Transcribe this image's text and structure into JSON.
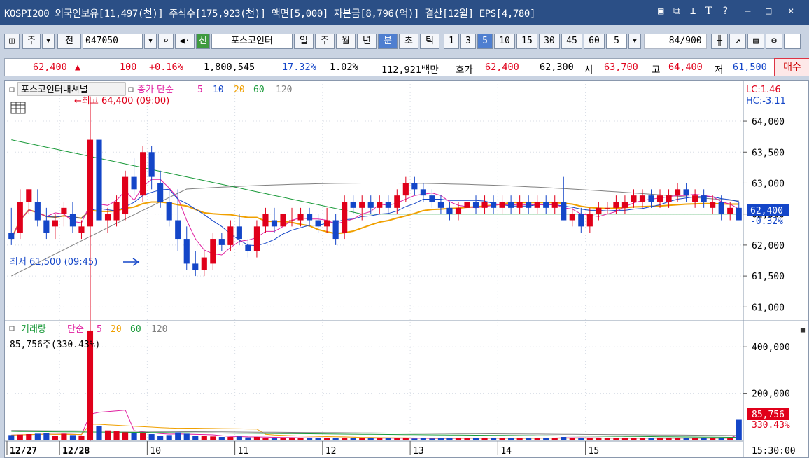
{
  "title_bar": {
    "text": "KOSPI200 외국인보유[11,497(천)] 주식수[175,923(천)] 액면[5,000] 자본금[8,796(억)] 결산[12월] EPS[4,780]",
    "icons": [
      "window-icon",
      "restore-icon",
      "pin-icon",
      "text-icon",
      "help-icon",
      "minimize-icon",
      "maximize-icon",
      "close-icon"
    ]
  },
  "toolbar": {
    "stock_type": "주",
    "prev": "전",
    "code": "047050",
    "market_badge": "신",
    "stock_name": "포스코인터",
    "periods": [
      "일",
      "주",
      "월",
      "년",
      "분",
      "초",
      "틱"
    ],
    "selected_period": "분",
    "intervals": [
      "1",
      "3",
      "5",
      "10",
      "15",
      "30",
      "45",
      "60"
    ],
    "selected_interval": "5",
    "interval_select": "5",
    "count": "84",
    "count_max": "/900"
  },
  "quote": {
    "price": "62,400",
    "arrow": "▲",
    "change": "100",
    "change_pct": "+0.16%",
    "volume": "1,800,545",
    "turnover": "17.32%",
    "ratio": "1.02%",
    "amount": "112,921백만",
    "ask_label": "호가",
    "ask": "62,400",
    "bid": "62,300",
    "open_label": "시",
    "open": "63,700",
    "high_label": "고",
    "high": "64,400",
    "low_label": "저",
    "low": "61,500",
    "buy_button": "매수"
  },
  "price_chart": {
    "name_tab": "포스코인터내셔널",
    "legend_prefix": "종가 단순",
    "ma_periods": [
      "5",
      "10",
      "20",
      "60",
      "120"
    ],
    "high_annotation": "←최고 64,400 (09:00)",
    "low_annotation": "최저 61,500 (09:45)",
    "lc": "LC:1.46",
    "hc": "HC:-3.11",
    "y_ticks": [
      "64,000",
      "63,500",
      "63,000",
      "62,500",
      "62,000",
      "61,500",
      "61,000"
    ],
    "current_price": "62,400",
    "current_pct": "-0.32%"
  },
  "volume_chart": {
    "legend_label": "거래량",
    "legend_prefix": "단순",
    "ma_periods": [
      "5",
      "20",
      "60",
      "120"
    ],
    "info": "85,756주(330.43%)",
    "y_ticks": [
      "400,000",
      "200,000"
    ],
    "current_value": "85,756",
    "current_pct": "330.43%"
  },
  "x_axis": {
    "labels": [
      "12/27",
      "12/28",
      "10",
      "11",
      "12",
      "13",
      "14",
      "15"
    ],
    "time": "15:30:00"
  },
  "colors": {
    "up": "#e0001a",
    "down": "#1446c8",
    "ma5": "#e020a0",
    "ma10": "#1446c8",
    "ma20": "#f0a000",
    "ma60": "#1a9a3a",
    "ma120": "#808080"
  },
  "chart_data": [
    {
      "type": "candlestick",
      "series": [
        {
          "name": "포스코인터내셔널",
          "candles": [
            [
              62200,
              62600,
              62000,
              62100
            ],
            [
              62200,
              62900,
              62100,
              62700
            ],
            [
              62700,
              62900,
              62500,
              62900
            ],
            [
              62700,
              62900,
              62300,
              62400
            ],
            [
              62400,
              62600,
              62100,
              62200
            ],
            [
              62300,
              62500,
              62100,
              62400
            ],
            [
              62500,
              62700,
              62300,
              62600
            ],
            [
              62500,
              62700,
              62200,
              62300
            ],
            [
              62200,
              62400,
              62100,
              62300
            ],
            [
              62300,
              64400,
              62100,
              63700
            ],
            [
              63700,
              63700,
              62300,
              62400
            ],
            [
              62400,
              62600,
              62200,
              62500
            ],
            [
              62400,
              62800,
              62300,
              62700
            ],
            [
              62500,
              63200,
              62400,
              63100
            ],
            [
              63100,
              63400,
              62800,
              62900
            ],
            [
              62800,
              63600,
              62700,
              63500
            ],
            [
              63500,
              63600,
              62900,
              63100
            ],
            [
              63000,
              63200,
              62600,
              62700
            ],
            [
              62700,
              62900,
              62300,
              62400
            ],
            [
              62400,
              62900,
              61900,
              62100
            ],
            [
              62100,
              62300,
              61600,
              61700
            ],
            [
              61700,
              61900,
              61500,
              61600
            ],
            [
              61600,
              61900,
              61500,
              61800
            ],
            [
              61700,
              62200,
              61600,
              62100
            ],
            [
              62100,
              62200,
              61900,
              62000
            ],
            [
              62000,
              62400,
              61900,
              62300
            ],
            [
              62300,
              62500,
              62000,
              62100
            ],
            [
              62000,
              62100,
              61800,
              61900
            ],
            [
              61900,
              62400,
              61800,
              62300
            ],
            [
              62300,
              62600,
              62200,
              62500
            ],
            [
              62400,
              62600,
              62200,
              62300
            ],
            [
              62300,
              62600,
              62200,
              62500
            ],
            [
              62400,
              62600,
              62300,
              62400
            ],
            [
              62400,
              62600,
              62300,
              62500
            ],
            [
              62500,
              62600,
              62300,
              62400
            ],
            [
              62400,
              62500,
              62200,
              62300
            ],
            [
              62300,
              62600,
              62200,
              62400
            ],
            [
              62400,
              62500,
              62000,
              62100
            ],
            [
              62200,
              62800,
              62100,
              62700
            ],
            [
              62700,
              62800,
              62500,
              62600
            ],
            [
              62600,
              62800,
              62400,
              62700
            ],
            [
              62700,
              62800,
              62500,
              62600
            ],
            [
              62600,
              62800,
              62500,
              62700
            ],
            [
              62700,
              62800,
              62500,
              62600
            ],
            [
              62600,
              62900,
              62500,
              62800
            ],
            [
              62800,
              63100,
              62700,
              63000
            ],
            [
              63000,
              63100,
              62800,
              62900
            ],
            [
              62900,
              63000,
              62700,
              62800
            ],
            [
              62800,
              62900,
              62600,
              62700
            ],
            [
              62700,
              62800,
              62500,
              62600
            ],
            [
              62600,
              62700,
              62400,
              62500
            ],
            [
              62500,
              62700,
              62400,
              62600
            ],
            [
              62600,
              62800,
              62500,
              62700
            ],
            [
              62700,
              62800,
              62500,
              62600
            ],
            [
              62600,
              62800,
              62500,
              62700
            ],
            [
              62700,
              62800,
              62500,
              62600
            ],
            [
              62600,
              62800,
              62500,
              62700
            ],
            [
              62700,
              62800,
              62500,
              62600
            ],
            [
              62600,
              62800,
              62500,
              62700
            ],
            [
              62700,
              62800,
              62500,
              62600
            ],
            [
              62600,
              62800,
              62500,
              62700
            ],
            [
              62700,
              62800,
              62500,
              62600
            ],
            [
              62600,
              62800,
              62500,
              62700
            ],
            [
              62700,
              63100,
              62400,
              62400
            ],
            [
              62400,
              62600,
              62300,
              62500
            ],
            [
              62500,
              62600,
              62200,
              62300
            ],
            [
              62300,
              62600,
              62200,
              62500
            ],
            [
              62500,
              62700,
              62400,
              62600
            ],
            [
              62600,
              62700,
              62500,
              62600
            ],
            [
              62600,
              62800,
              62500,
              62700
            ],
            [
              62600,
              62800,
              62500,
              62700
            ],
            [
              62700,
              62900,
              62600,
              62800
            ],
            [
              62700,
              62900,
              62600,
              62800
            ],
            [
              62800,
              62900,
              62600,
              62700
            ],
            [
              62700,
              62900,
              62600,
              62800
            ],
            [
              62700,
              62900,
              62600,
              62800
            ],
            [
              62800,
              63000,
              62700,
              62900
            ],
            [
              62900,
              63000,
              62700,
              62800
            ],
            [
              62700,
              62900,
              62600,
              62800
            ],
            [
              62800,
              62900,
              62600,
              62700
            ],
            [
              62600,
              62800,
              62500,
              62700
            ],
            [
              62700,
              62800,
              62400,
              62500
            ],
            [
              62500,
              62700,
              62400,
              62600
            ],
            [
              62600,
              62700,
              62400,
              62400
            ]
          ]
        }
      ],
      "ylim": [
        60800,
        64600
      ]
    },
    {
      "type": "bar",
      "series": [
        {
          "name": "거래량",
          "values": [
            20000,
            22000,
            24000,
            26000,
            28000,
            18000,
            26000,
            20000,
            16000,
            470000,
            60000,
            40000,
            36000,
            32000,
            28000,
            30000,
            24000,
            18000,
            20000,
            32000,
            26000,
            18000,
            16000,
            14000,
            12000,
            12000,
            14000,
            10000,
            12000,
            9000,
            8000,
            9000,
            8000,
            7000,
            8000,
            7000,
            9000,
            7000,
            8000,
            7000,
            6000,
            7000,
            6000,
            7000,
            6000,
            7000,
            5000,
            6000,
            5000,
            6000,
            7000,
            6000,
            7000,
            8000,
            6000,
            7000,
            6000,
            7000,
            6000,
            7000,
            8000,
            9000,
            7000,
            12000,
            8000,
            7000,
            6000,
            7000,
            6000,
            8000,
            7000,
            6000,
            7000,
            6000,
            7000,
            6000,
            7000,
            8000,
            6000,
            7000,
            6000,
            7000,
            8000,
            85756
          ]
        }
      ],
      "ylim": [
        0,
        500000
      ]
    }
  ]
}
